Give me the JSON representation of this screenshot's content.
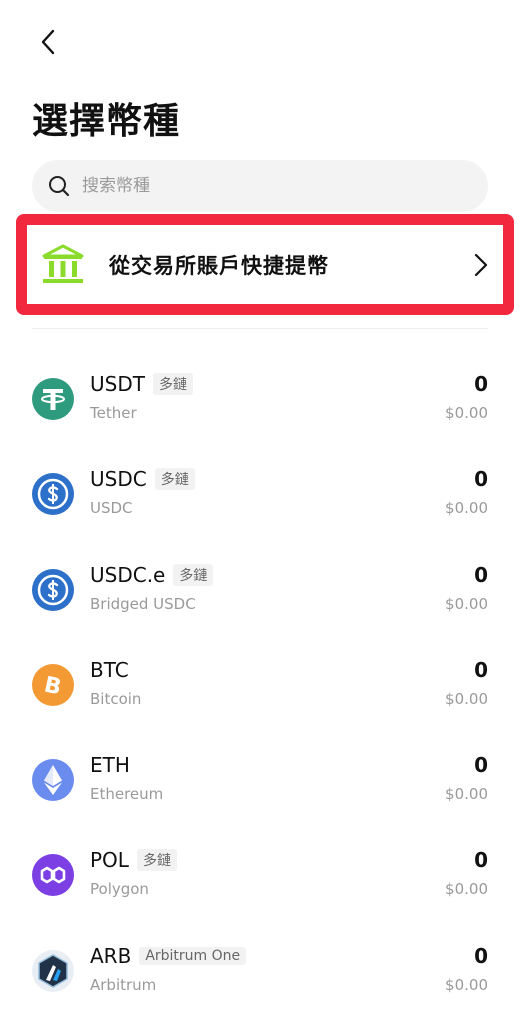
{
  "header": {
    "title": "選擇幣種"
  },
  "search": {
    "placeholder": "搜索幣種"
  },
  "quick_withdraw": {
    "label": "從交易所賬戶快捷提幣"
  },
  "colors": {
    "highlight": "#f2283f",
    "bank_icon": "#8bdb2c"
  },
  "coins": [
    {
      "symbol": "USDT",
      "badge": "多鏈",
      "name": "Tether",
      "amount": "0",
      "usd": "$0.00",
      "icon": "tether-icon",
      "color": "#2e9b7e"
    },
    {
      "symbol": "USDC",
      "badge": "多鏈",
      "name": "USDC",
      "amount": "0",
      "usd": "$0.00",
      "icon": "usdc-icon",
      "color": "#2c70c9"
    },
    {
      "symbol": "USDC.e",
      "badge": "多鏈",
      "name": "Bridged USDC",
      "amount": "0",
      "usd": "$0.00",
      "icon": "usdc-icon",
      "color": "#2c70c9"
    },
    {
      "symbol": "BTC",
      "badge": "",
      "name": "Bitcoin",
      "amount": "0",
      "usd": "$0.00",
      "icon": "bitcoin-icon",
      "color": "#f39a34"
    },
    {
      "symbol": "ETH",
      "badge": "",
      "name": "Ethereum",
      "amount": "0",
      "usd": "$0.00",
      "icon": "ethereum-icon",
      "color": "#6b8cef"
    },
    {
      "symbol": "POL",
      "badge": "多鏈",
      "name": "Polygon",
      "amount": "0",
      "usd": "$0.00",
      "icon": "polygon-icon",
      "color": "#7b3fe4"
    },
    {
      "symbol": "ARB",
      "badge": "Arbitrum One",
      "name": "Arbitrum",
      "amount": "0",
      "usd": "$0.00",
      "icon": "arbitrum-icon",
      "color": "#213147"
    }
  ]
}
